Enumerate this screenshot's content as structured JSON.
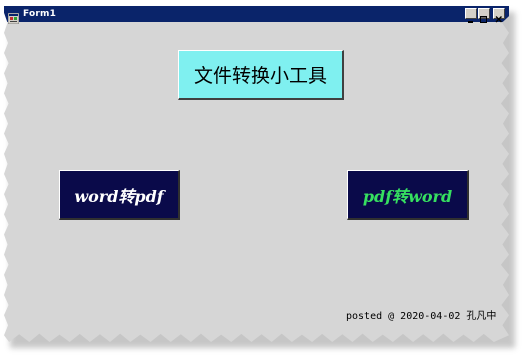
{
  "window": {
    "title": "Form1",
    "title_bar_color": "#0a246a",
    "form_background": "#d6d6d6",
    "icons": [
      "app-icon",
      "minimize-icon",
      "maximize-icon",
      "close-icon"
    ]
  },
  "buttons": {
    "title_label": "文件转换小工具",
    "title_color": "#7ff0f0",
    "word_to_pdf_label": "word转pdf",
    "word_to_pdf_text_color": "#ffffff",
    "pdf_to_word_label": "pdf转word",
    "pdf_to_word_text_color": "#36e060",
    "conversion_button_color": "#0a0a4a"
  },
  "footer": {
    "text": "posted @ 2020-04-02 孔凡中"
  }
}
